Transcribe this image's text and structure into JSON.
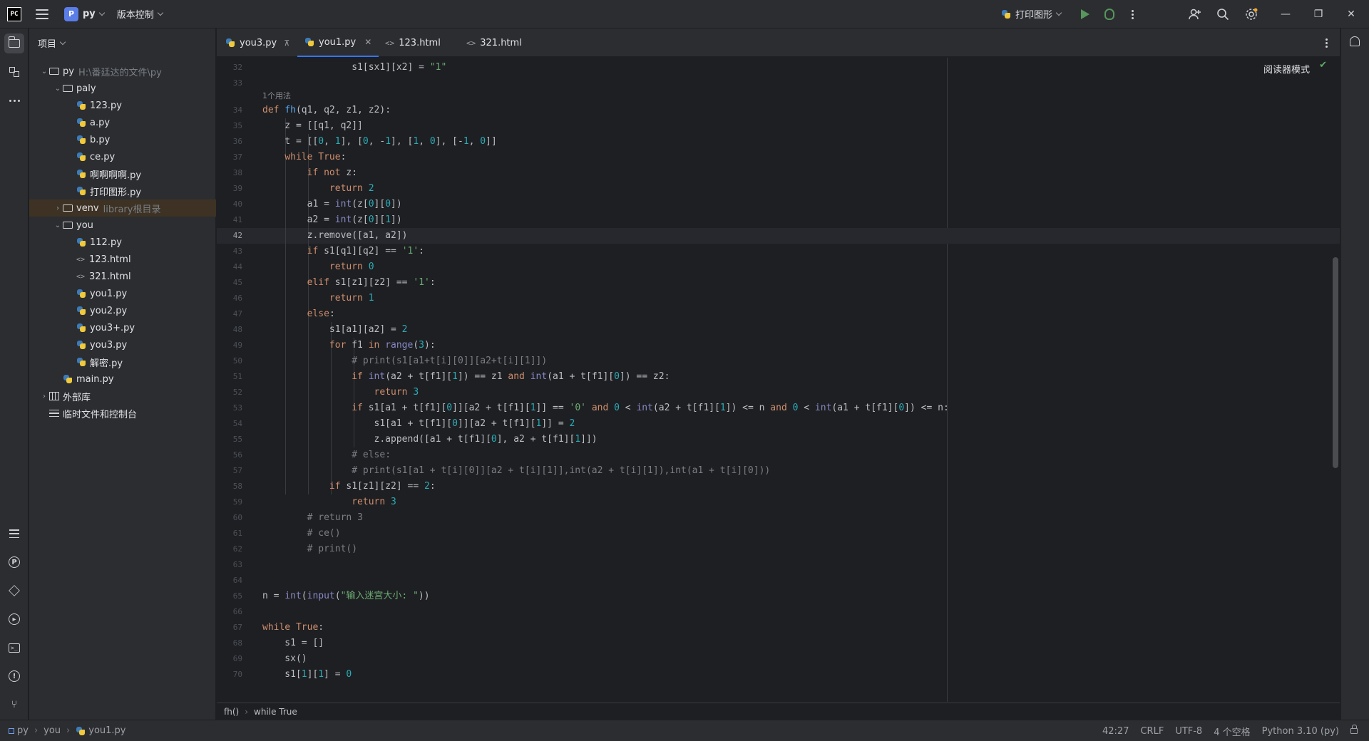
{
  "titlebar": {
    "logo": "PC",
    "project_letter": "P",
    "project_name": "py",
    "vcs_label": "版本控制",
    "run_config": "打印图形"
  },
  "panel": {
    "header": "项目",
    "tree": [
      {
        "label": "py",
        "hint": "H:\\番廷达的文件\\py",
        "kind": "folder",
        "depth": 0,
        "expanded": true
      },
      {
        "label": "paly",
        "kind": "folder",
        "depth": 1,
        "expanded": true
      },
      {
        "label": "123.py",
        "kind": "py",
        "depth": 2
      },
      {
        "label": "a.py",
        "kind": "py",
        "depth": 2
      },
      {
        "label": "b.py",
        "kind": "py",
        "depth": 2
      },
      {
        "label": "ce.py",
        "kind": "py",
        "depth": 2
      },
      {
        "label": "啊啊啊啊.py",
        "kind": "py",
        "depth": 2
      },
      {
        "label": "打印图形.py",
        "kind": "py",
        "depth": 2
      },
      {
        "label": "venv",
        "hint": "library根目录",
        "kind": "folder",
        "depth": 1,
        "expanded": false,
        "selected": true
      },
      {
        "label": "you",
        "kind": "folder",
        "depth": 1,
        "expanded": true
      },
      {
        "label": "112.py",
        "kind": "py",
        "depth": 2
      },
      {
        "label": "123.html",
        "kind": "html",
        "depth": 2
      },
      {
        "label": "321.html",
        "kind": "html",
        "depth": 2
      },
      {
        "label": "you1.py",
        "kind": "py",
        "depth": 2
      },
      {
        "label": "you2.py",
        "kind": "py",
        "depth": 2
      },
      {
        "label": "you3+.py",
        "kind": "py",
        "depth": 2
      },
      {
        "label": "you3.py",
        "kind": "py",
        "depth": 2
      },
      {
        "label": "解密.py",
        "kind": "py",
        "depth": 2
      },
      {
        "label": "main.py",
        "kind": "py",
        "depth": 1
      },
      {
        "label": "外部库",
        "kind": "lib",
        "depth": 0,
        "expanded": false
      },
      {
        "label": "临时文件和控制台",
        "kind": "scratch",
        "depth": 0
      }
    ]
  },
  "tabs": [
    {
      "label": "you3.py",
      "kind": "py"
    },
    {
      "label": "you1.py",
      "kind": "py",
      "active": true
    },
    {
      "label": "123.html",
      "kind": "html"
    },
    {
      "label": "321.html",
      "kind": "html"
    }
  ],
  "editor": {
    "reader_mode": "阅读器模式",
    "usage_hint": "1个用法",
    "current_line": 42,
    "lines": [
      {
        "n": 32,
        "code": "                s1[sx1][x2] = \"1\""
      },
      {
        "n": 33,
        "code": ""
      },
      {
        "n": 34,
        "code": "def fh(q1, q2, z1, z2):"
      },
      {
        "n": 35,
        "code": "    z = [[q1, q2]]"
      },
      {
        "n": 36,
        "code": "    t = [[0, 1], [0, -1], [1, 0], [-1, 0]]"
      },
      {
        "n": 37,
        "code": "    while True:"
      },
      {
        "n": 38,
        "code": "        if not z:"
      },
      {
        "n": 39,
        "code": "            return 2"
      },
      {
        "n": 40,
        "code": "        a1 = int(z[0][0])"
      },
      {
        "n": 41,
        "code": "        a2 = int(z[0][1])"
      },
      {
        "n": 42,
        "code": "        z.remove([a1, a2])"
      },
      {
        "n": 43,
        "code": "        if s1[q1][q2] == '1':"
      },
      {
        "n": 44,
        "code": "            return 0"
      },
      {
        "n": 45,
        "code": "        elif s1[z1][z2] == '1':"
      },
      {
        "n": 46,
        "code": "            return 1"
      },
      {
        "n": 47,
        "code": "        else:"
      },
      {
        "n": 48,
        "code": "            s1[a1][a2] = 2"
      },
      {
        "n": 49,
        "code": "            for f1 in range(3):"
      },
      {
        "n": 50,
        "code": "                # print(s1[a1+t[i][0]][a2+t[i][1]])"
      },
      {
        "n": 51,
        "code": "                if int(a2 + t[f1][1]) == z1 and int(a1 + t[f1][0]) == z2:"
      },
      {
        "n": 52,
        "code": "                    return 3"
      },
      {
        "n": 53,
        "code": "                if s1[a1 + t[f1][0]][a2 + t[f1][1]] == '0' and 0 < int(a2 + t[f1][1]) <= n and 0 < int(a1 + t[f1][0]) <= n:"
      },
      {
        "n": 54,
        "code": "                    s1[a1 + t[f1][0]][a2 + t[f1][1]] = 2"
      },
      {
        "n": 55,
        "code": "                    z.append([a1 + t[f1][0], a2 + t[f1][1]])"
      },
      {
        "n": 56,
        "code": "                # else:"
      },
      {
        "n": 57,
        "code": "                # print(s1[a1 + t[i][0]][a2 + t[i][1]],int(a2 + t[i][1]),int(a1 + t[i][0]))"
      },
      {
        "n": 58,
        "code": "            if s1[z1][z2] == 2:"
      },
      {
        "n": 59,
        "code": "                return 3"
      },
      {
        "n": 60,
        "code": "        # return 3"
      },
      {
        "n": 61,
        "code": "        # ce()"
      },
      {
        "n": 62,
        "code": "        # print()"
      },
      {
        "n": 63,
        "code": ""
      },
      {
        "n": 64,
        "code": ""
      },
      {
        "n": 65,
        "code": "n = int(input(\"输入迷宫大小: \"))"
      },
      {
        "n": 66,
        "code": ""
      },
      {
        "n": 67,
        "code": "while True:"
      },
      {
        "n": 68,
        "code": "    s1 = []"
      },
      {
        "n": 69,
        "code": "    sx()"
      },
      {
        "n": 70,
        "code": "    s1[1][1] = 0"
      }
    ]
  },
  "breadcrumbs": [
    "fh()",
    "while True"
  ],
  "statusbar": {
    "path": [
      "py",
      "you",
      "you1.py"
    ],
    "position": "42:27",
    "line_sep": "CRLF",
    "encoding": "UTF-8",
    "indent": "4 个空格",
    "interpreter": "Python 3.10 (py)"
  },
  "colors": {
    "accent": "#3574f0",
    "keyword": "#cf8e6d",
    "function": "#56a8f5",
    "number": "#2aacb8",
    "string": "#6aab73",
    "comment": "#7a7e85"
  }
}
